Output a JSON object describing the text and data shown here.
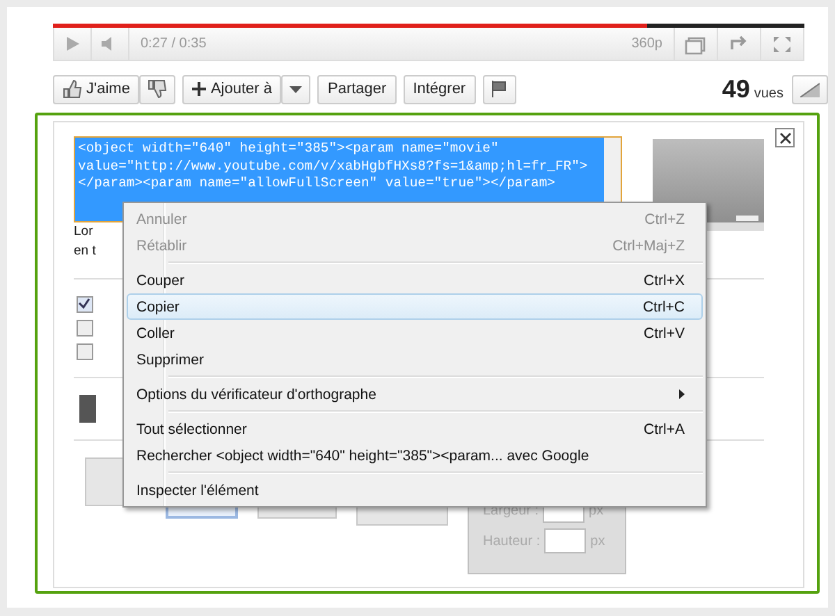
{
  "player": {
    "level": 0.79,
    "time": "0:27 / 0:35",
    "quality": "360p"
  },
  "actions": {
    "like": "J'aime",
    "add": "Ajouter à",
    "share": "Partager",
    "embed": "Intégrer"
  },
  "views": {
    "count": "49",
    "label": "vues"
  },
  "embed_panel": {
    "code_lines": [
      "<object width=\"640\" height=\"385\"><param name=\"movie\"",
      "value=\"http://www.youtube.com/v/xabHgbfHXs8?fs=1&amp;hl=fr_FR\">",
      "</param><param name=\"allowFullScreen\" value=\"true\"></param>"
    ],
    "text_lines": [
      "Lor",
      "en t"
    ],
    "checkboxes": [
      {
        "checked": true
      },
      {
        "checked": false
      },
      {
        "checked": false
      }
    ],
    "sizes": [
      {
        "selected": false
      },
      {
        "selected": true
      },
      {
        "selected": false
      },
      {
        "selected": false
      }
    ],
    "custom_fields": [
      {
        "label": "Largeur :",
        "unit": "px"
      },
      {
        "label": "Hauteur :",
        "unit": "px"
      }
    ]
  },
  "context_menu": [
    {
      "kind": "item",
      "label": "Annuler",
      "shortcut": "Ctrl+Z",
      "disabled": true,
      "selected": false
    },
    {
      "kind": "item",
      "label": "Rétablir",
      "shortcut": "Ctrl+Maj+Z",
      "disabled": true,
      "selected": false
    },
    {
      "kind": "separator"
    },
    {
      "kind": "item",
      "label": "Couper",
      "shortcut": "Ctrl+X",
      "disabled": false,
      "selected": false
    },
    {
      "kind": "item",
      "label": "Copier",
      "shortcut": "Ctrl+C",
      "disabled": false,
      "selected": true
    },
    {
      "kind": "item",
      "label": "Coller",
      "shortcut": "Ctrl+V",
      "disabled": false,
      "selected": false
    },
    {
      "kind": "item",
      "label": "Supprimer",
      "disabled": false,
      "selected": false
    },
    {
      "kind": "separator"
    },
    {
      "kind": "item",
      "label": "Options du vérificateur d'orthographe",
      "submenu": true,
      "disabled": false,
      "selected": false
    },
    {
      "kind": "separator"
    },
    {
      "kind": "item",
      "label": "Tout sélectionner",
      "shortcut": "Ctrl+A",
      "disabled": false,
      "selected": false
    },
    {
      "kind": "item",
      "label": "Rechercher <object width=\"640\" height=\"385\"><param... avec Google",
      "disabled": false,
      "selected": false
    },
    {
      "kind": "separator"
    },
    {
      "kind": "item",
      "label": "Inspecter l'élément",
      "disabled": false,
      "selected": false
    }
  ]
}
